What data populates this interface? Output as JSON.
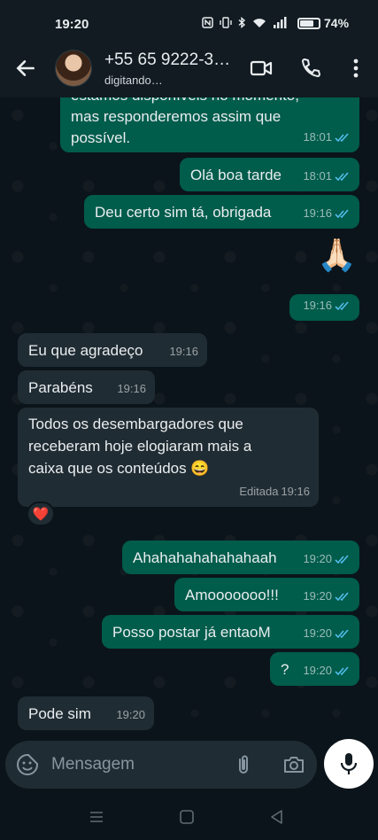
{
  "status_bar": {
    "time": "19:20",
    "battery_percent": "74%",
    "battery_level": 0.74
  },
  "header": {
    "contact_name": "+55 65 9222-3…",
    "status": "digitando…",
    "icons": [
      "back-arrow-icon",
      "video-call-icon",
      "phone-call-icon",
      "more-options-icon"
    ]
  },
  "messages": [
    {
      "direction": "out",
      "text": "estamos disponíveis no momento,\nmas responderemos assim que\npossível.",
      "time": "18:01",
      "read": true
    },
    {
      "direction": "out",
      "text": "Olá boa tarde",
      "time": "18:01",
      "read": true
    },
    {
      "direction": "out",
      "text": "Deu certo sim tá, obrigada",
      "time": "19:16",
      "read": true
    },
    {
      "direction": "out",
      "emoji": "🙏🏻",
      "time": "19:16",
      "read": true
    },
    {
      "direction": "in",
      "text": "Eu que agradeço",
      "time": "19:16"
    },
    {
      "direction": "in",
      "text": "Parabéns",
      "time": "19:16"
    },
    {
      "direction": "in",
      "text": "Todos os desembargadores que\nreceberam hoje elogiaram mais a\ncaixa que os conteúdos 😄",
      "edited_label": "Editada",
      "time": "19:16",
      "reaction": "❤️"
    },
    {
      "direction": "out",
      "text": "Ahahahahahahahaah",
      "time": "19:20",
      "read": true
    },
    {
      "direction": "out",
      "text": "Amooooooo!!!",
      "time": "19:20",
      "read": true
    },
    {
      "direction": "out",
      "text": "Posso postar já entaoM",
      "time": "19:20",
      "read": true
    },
    {
      "direction": "out",
      "text": "?",
      "time": "19:20",
      "read": true
    },
    {
      "direction": "in",
      "text": "Pode sim",
      "time": "19:20"
    }
  ],
  "composer": {
    "placeholder": "Mensagem",
    "icons": [
      "emoji-sticker-icon",
      "attach-clip-icon",
      "camera-icon",
      "microphone-icon"
    ]
  },
  "colors": {
    "outgoing_bubble": "#005c4b",
    "incoming_bubble": "#202c33",
    "read_ticks": "#53bdeb",
    "background": "#0b141a"
  }
}
